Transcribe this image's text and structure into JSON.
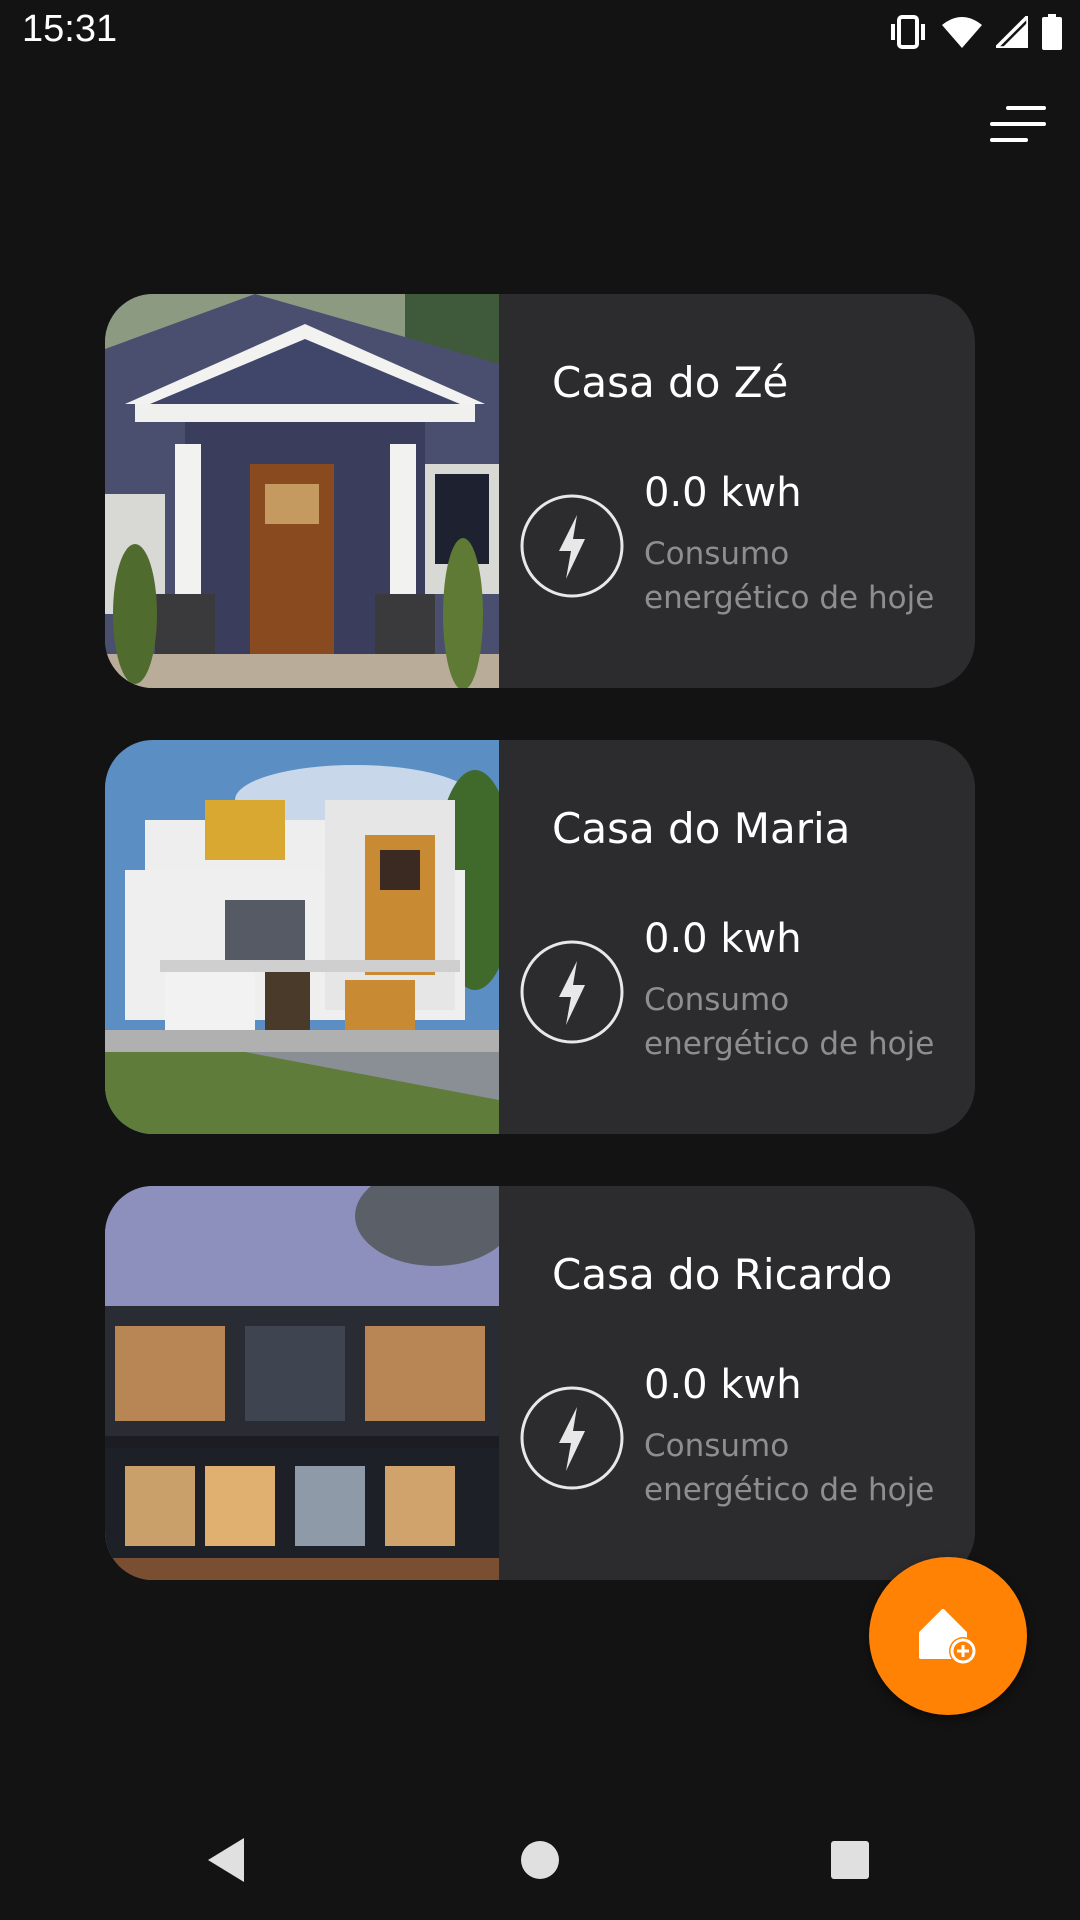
{
  "status_bar": {
    "time": "15:31",
    "icons": [
      "vibrate-icon",
      "wifi-icon",
      "signal-icon",
      "battery-icon"
    ]
  },
  "header": {
    "menu_icon": "sort-menu-icon"
  },
  "houses": [
    {
      "name": "Casa do Zé",
      "energy_value": "0.0 kwh",
      "energy_label": "Consumo energético de hoje",
      "image": "house-photo-craftsman"
    },
    {
      "name": "Casa do Maria",
      "energy_value": "0.0 kwh",
      "energy_label": "Consumo energético de hoje",
      "image": "house-photo-modern-white-yellow"
    },
    {
      "name": "Casa do Ricardo",
      "energy_value": "0.0 kwh",
      "energy_label": "Consumo energético de hoje",
      "image": "house-photo-modern-dark"
    }
  ],
  "fab": {
    "icon": "add-home-icon"
  },
  "nav_bar": {
    "icons": [
      "back-icon",
      "home-icon",
      "recents-icon"
    ]
  },
  "colors": {
    "background": "#131314",
    "card": "#2c2c2e",
    "accent": "#ff8205",
    "muted_text": "#8e8e90"
  }
}
